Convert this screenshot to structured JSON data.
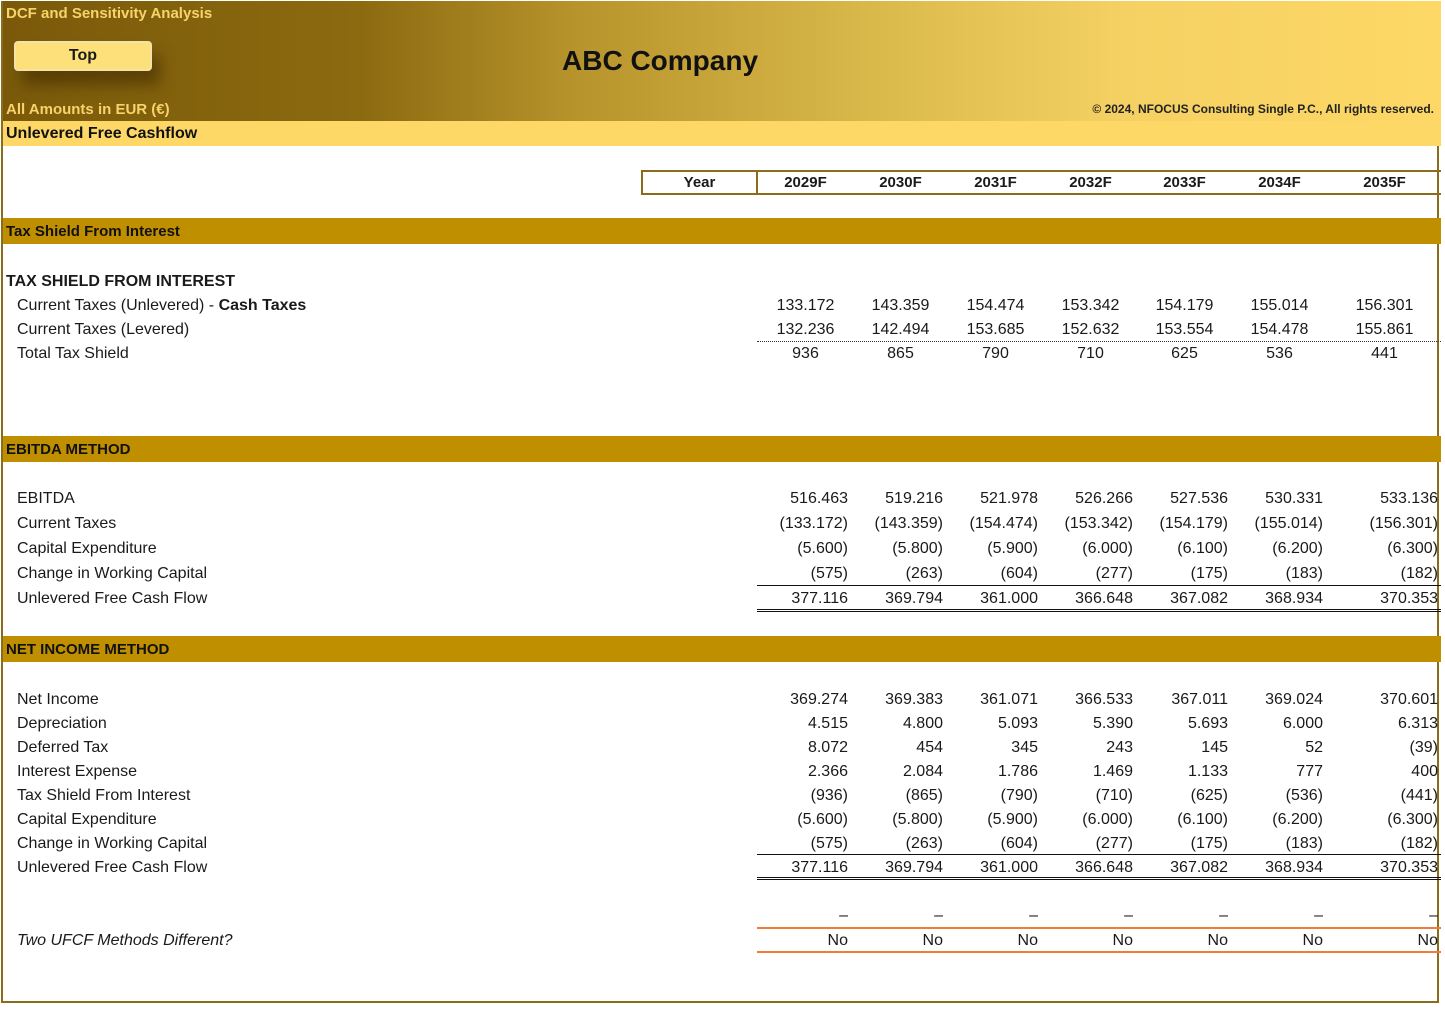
{
  "app_title": "DCF and Sensitivity Analysis",
  "top_button": "Top",
  "company": "ABC Company",
  "currency_note": "All Amounts in  EUR (€)",
  "copyright": "© 2024, NFOCUS Consulting Single P.C., All rights reserved.",
  "subtitle": "Unlevered Free Cashflow",
  "year_label": "Year",
  "years": [
    "2029F",
    "2030F",
    "2031F",
    "2032F",
    "2033F",
    "2034F",
    "2035F"
  ],
  "colors": {
    "banner_dark": "#7a5a0a",
    "banner_light": "#fdd866",
    "section": "#bf8f00",
    "check_line": "#f07c3a"
  },
  "tax_shield_section": {
    "bar_title": "Tax Shield From Interest",
    "heading": "TAX SHIELD FROM INTEREST",
    "rows": [
      {
        "label": "Current Taxes (Unlevered) - ",
        "label_bold": "Cash Taxes",
        "values": [
          "133.172",
          "143.359",
          "154.474",
          "153.342",
          "154.179",
          "155.014",
          "156.301"
        ]
      },
      {
        "label": "Current Taxes (Levered)",
        "values": [
          "132.236",
          "142.494",
          "153.685",
          "152.632",
          "153.554",
          "154.478",
          "155.861"
        ]
      },
      {
        "label": "Total Tax Shield",
        "values": [
          "936",
          "865",
          "790",
          "710",
          "625",
          "536",
          "441"
        ]
      }
    ]
  },
  "ebitda_section": {
    "bar_title": "EBITDA METHOD",
    "rows": [
      {
        "label": "EBITDA",
        "values": [
          "516.463",
          "519.216",
          "521.978",
          "526.266",
          "527.536",
          "530.331",
          "533.136"
        ]
      },
      {
        "label": "Current Taxes",
        "values": [
          "(133.172)",
          "(143.359)",
          "(154.474)",
          "(153.342)",
          "(154.179)",
          "(155.014)",
          "(156.301)"
        ]
      },
      {
        "label": "Capital Expenditure",
        "values": [
          "(5.600)",
          "(5.800)",
          "(5.900)",
          "(6.000)",
          "(6.100)",
          "(6.200)",
          "(6.300)"
        ]
      },
      {
        "label": "Change in Working Capital",
        "values": [
          "(575)",
          "(263)",
          "(604)",
          "(277)",
          "(175)",
          "(183)",
          "(182)"
        ]
      },
      {
        "label": "Unlevered Free Cash Flow",
        "values": [
          "377.116",
          "369.794",
          "361.000",
          "366.648",
          "367.082",
          "368.934",
          "370.353"
        ]
      }
    ]
  },
  "net_income_section": {
    "bar_title": "NET INCOME METHOD",
    "rows": [
      {
        "label": "Net Income",
        "values": [
          "369.274",
          "369.383",
          "361.071",
          "366.533",
          "367.011",
          "369.024",
          "370.601"
        ]
      },
      {
        "label": "Depreciation",
        "values": [
          "4.515",
          "4.800",
          "5.093",
          "5.390",
          "5.693",
          "6.000",
          "6.313"
        ]
      },
      {
        "label": "Deferred Tax",
        "values": [
          "8.072",
          "454",
          "345",
          "243",
          "145",
          "52",
          "(39)"
        ]
      },
      {
        "label": "Interest Expense",
        "values": [
          "2.366",
          "2.084",
          "1.786",
          "1.469",
          "1.133",
          "777",
          "400"
        ]
      },
      {
        "label": "Tax Shield From Interest",
        "values": [
          "(936)",
          "(865)",
          "(790)",
          "(710)",
          "(625)",
          "(536)",
          "(441)"
        ]
      },
      {
        "label": "Capital Expenditure",
        "values": [
          "(5.600)",
          "(5.800)",
          "(5.900)",
          "(6.000)",
          "(6.100)",
          "(6.200)",
          "(6.300)"
        ]
      },
      {
        "label": "Change in Working Capital",
        "values": [
          "(575)",
          "(263)",
          "(604)",
          "(277)",
          "(175)",
          "(183)",
          "(182)"
        ]
      },
      {
        "label": "Unlevered Free Cash Flow",
        "values": [
          "377.116",
          "369.794",
          "361.000",
          "366.648",
          "367.082",
          "368.934",
          "370.353"
        ]
      }
    ]
  },
  "check": {
    "difference_values": [
      "–",
      "–",
      "–",
      "–",
      "–",
      "–",
      "–"
    ],
    "label": "Two UFCF Methods Different?",
    "values": [
      "No",
      "No",
      "No",
      "No",
      "No",
      "No",
      "No"
    ]
  }
}
